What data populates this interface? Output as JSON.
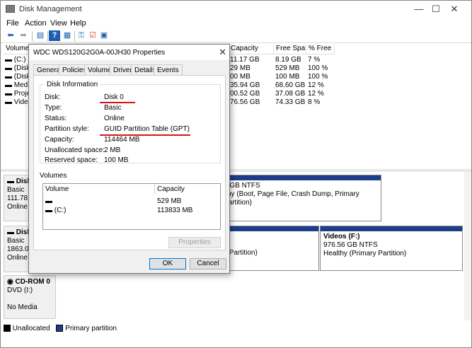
{
  "app": {
    "title": "Disk Management"
  },
  "window_controls": {
    "minimize": "—",
    "maximize": "☐",
    "close": "✕"
  },
  "menu": [
    "File",
    "Action",
    "View",
    "Help"
  ],
  "volume_table": {
    "columns": [
      "Volume",
      "Capacity",
      "Free Spa",
      "% Free"
    ],
    "rows": [
      {
        "volume": "(C:)",
        "capacity": "11.17 GB",
        "free": "8.19 GB",
        "pct": "7 %"
      },
      {
        "volume": "(Disk",
        "capacity": "29 MB",
        "free": "529 MB",
        "pct": "100 %"
      },
      {
        "volume": "(Disk",
        "capacity": "00 MB",
        "free": "100 MB",
        "pct": "100 %"
      },
      {
        "volume": "Media",
        "capacity": "35.94 GB",
        "free": "68.60 GB",
        "pct": "12 %"
      },
      {
        "volume": "Projec",
        "capacity": "00.52 GB",
        "free": "37.08 GB",
        "pct": "12 %"
      },
      {
        "volume": "Video",
        "capacity": "76.56 GB",
        "free": "74.33 GB",
        "pct": "8 %"
      }
    ]
  },
  "disks": [
    {
      "name": "Disk",
      "type": "Basic",
      "size": "111.78 G",
      "status": "Online"
    },
    {
      "name": "Disk",
      "type": "Basic",
      "size": "1863.02",
      "status": "Online"
    },
    {
      "name": "CD-ROM 0",
      "type": "DVD (I:)",
      "size": "",
      "status": "No Media"
    }
  ],
  "partitions": {
    "disk0_main": {
      "size": "7 GB NTFS",
      "status": "lthy (Boot, Page File, Crash Dump, Primary Partition)"
    },
    "disk1_left": {
      "status": "y Partition)"
    },
    "disk1_videos": {
      "name": "Videos (F:)",
      "size": "976.56 GB NTFS",
      "status": "Healthy (Primary Partition)"
    }
  },
  "legend": {
    "unallocated": "Unallocated",
    "primary": "Primary partition"
  },
  "colors": {
    "primary": "#1c3d8a",
    "unallocated": "#000000",
    "accent": "#0078d7",
    "highlight": "#d11111"
  },
  "dialog": {
    "title": "WDC WDS120G2G0A-00JH30 Properties",
    "tabs": [
      "General",
      "Policies",
      "Volumes",
      "Driver",
      "Details",
      "Events"
    ],
    "active_tab": "Volumes",
    "disk_info": {
      "heading": "Disk Information",
      "fields": [
        {
          "label": "Disk:",
          "value": "Disk 0"
        },
        {
          "label": "Type:",
          "value": "Basic"
        },
        {
          "label": "Status:",
          "value": "Online"
        },
        {
          "label": "Partition style:",
          "value": "GUID Partition Table (GPT)"
        },
        {
          "label": "Capacity:",
          "value": "114464 MB"
        },
        {
          "label": "Unallocated space:",
          "value": "2 MB"
        },
        {
          "label": "Reserved space:",
          "value": "100 MB"
        }
      ]
    },
    "volumes": {
      "heading": "Volumes",
      "columns": [
        "Volume",
        "Capacity"
      ],
      "rows": [
        {
          "volume": "",
          "capacity": "529 MB"
        },
        {
          "volume": "(C:)",
          "capacity": "113833 MB"
        }
      ]
    },
    "properties_button": "Properties",
    "ok_button": "OK",
    "cancel_button": "Cancel"
  }
}
